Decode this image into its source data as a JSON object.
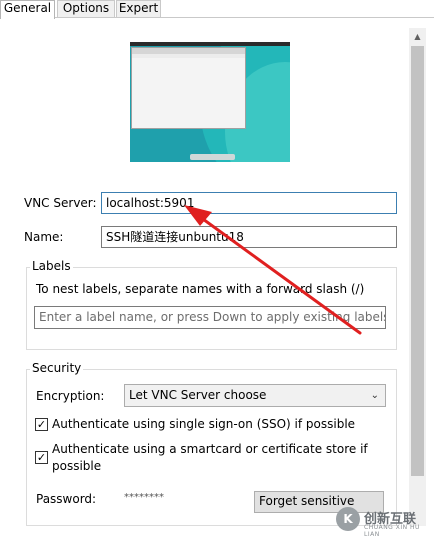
{
  "tabs": [
    {
      "label": "General",
      "active": true
    },
    {
      "label": "Options",
      "active": false
    },
    {
      "label": "Expert",
      "active": false
    }
  ],
  "preview": {
    "icon": "desktop-thumbnail"
  },
  "vnc_server": {
    "label": "VNC Server:",
    "value": "localhost:5901"
  },
  "name": {
    "label": "Name:",
    "value": "SSH隧道连接unbuntu18"
  },
  "labels_group": {
    "legend": "Labels",
    "hint": "To nest labels, separate names with a forward slash (/)",
    "placeholder": "Enter a label name, or press Down to apply existing labels"
  },
  "security_group": {
    "legend": "Security",
    "encryption_label": "Encryption:",
    "encryption_value": "Let VNC Server choose",
    "sso": {
      "label": "Authenticate using single sign-on (SSO) if possible",
      "checked": true
    },
    "smartcard": {
      "label_line1": "Authenticate using a smartcard or certificate store if",
      "label_line2": "possible",
      "checked": true
    },
    "password_label": "Password:",
    "password_value": "********",
    "forget_button": "Forget sensitive"
  },
  "watermark": {
    "logo": "K",
    "text": "创新互联",
    "sub": "CHUANG XIN HU LIAN"
  },
  "colors": {
    "annotation_arrow": "#e02020",
    "focus_border": "#3c7fb1"
  }
}
